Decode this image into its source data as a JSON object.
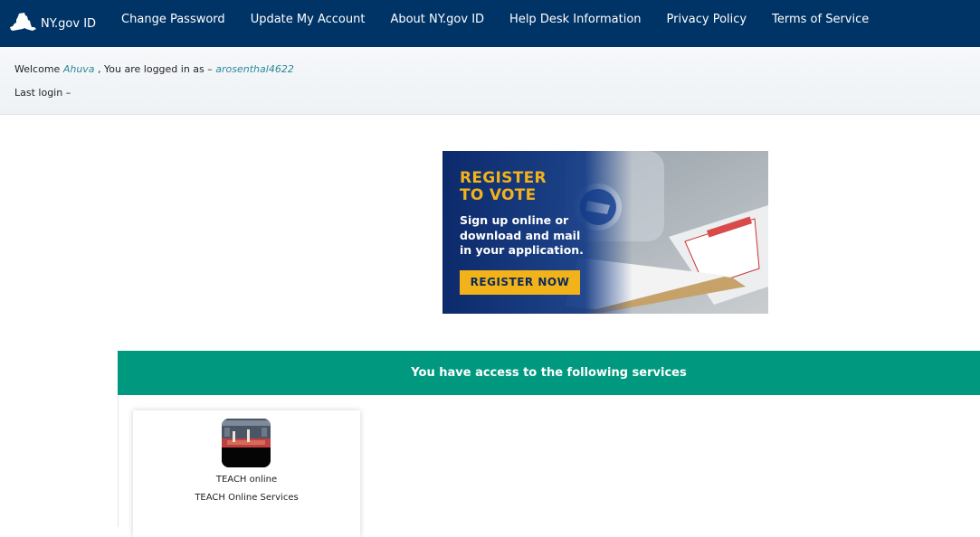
{
  "nav": {
    "brand_label": "NY.gov ID",
    "items": [
      {
        "label": "Change Password"
      },
      {
        "label": "Update My Account"
      },
      {
        "label": "About NY.gov ID"
      },
      {
        "label": "Help Desk Information"
      },
      {
        "label": "Privacy Policy"
      },
      {
        "label": "Terms of Service"
      }
    ]
  },
  "welcome": {
    "prefix": "Welcome",
    "name": "Ahuva",
    "logged_in_text": ", You are logged in as –",
    "username": "arosenthal4622",
    "last_login": "Last login –"
  },
  "banner": {
    "title_line1": "REGISTER",
    "title_line2": "TO VOTE",
    "text": "Sign up online or download and mail in your application.",
    "button": "REGISTER NOW",
    "accent": "#f2b21a"
  },
  "services": {
    "header": "You have access to the following services",
    "header_color": "#00997f",
    "items": [
      {
        "name": "TEACH online",
        "description": "TEACH Online Services",
        "icon": "teach-icon"
      }
    ]
  },
  "colors": {
    "nav_bg": "#003366",
    "link": "#2a8a9a"
  }
}
